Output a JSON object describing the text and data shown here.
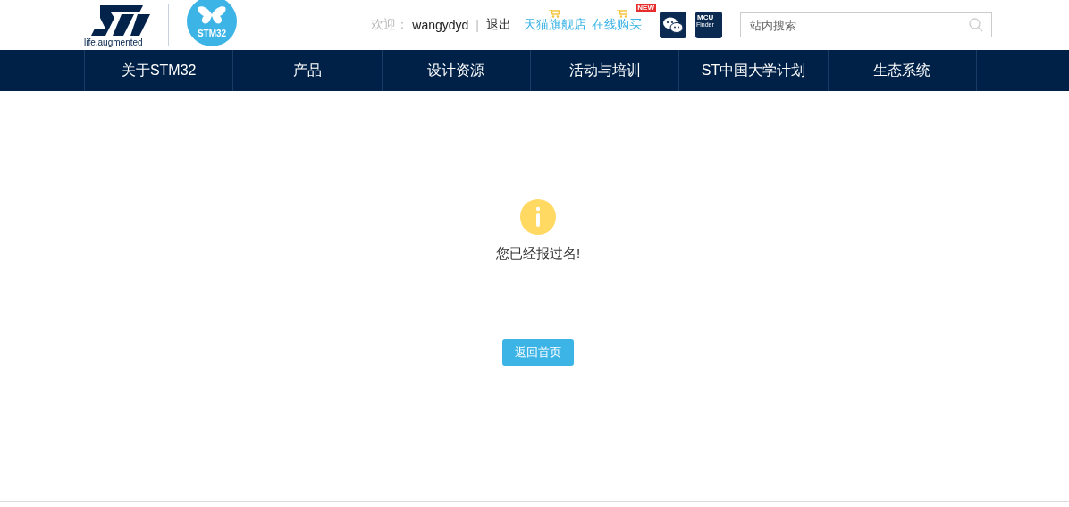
{
  "header": {
    "logo_tagline": "life.augmented",
    "badge_logo_text": "STM32",
    "welcome_label": "欢迎：",
    "username": "wangydyd",
    "separator": "|",
    "logout": "退出",
    "links": [
      {
        "label": "天猫旗舰店"
      },
      {
        "label": "在线购买",
        "badge": "NEW"
      }
    ],
    "mcu_finder": {
      "line_1": "MCU",
      "line_2": "Finder"
    },
    "search": {
      "placeholder": "站内搜索"
    }
  },
  "nav": {
    "items": [
      {
        "label": "关于STM32"
      },
      {
        "label": "产品"
      },
      {
        "label": "设计资源"
      },
      {
        "label": "活动与培训"
      },
      {
        "label": "ST中国大学计划"
      },
      {
        "label": "生态系统"
      }
    ]
  },
  "notice": {
    "message": "您已经报过名!",
    "button": "返回首页"
  }
}
